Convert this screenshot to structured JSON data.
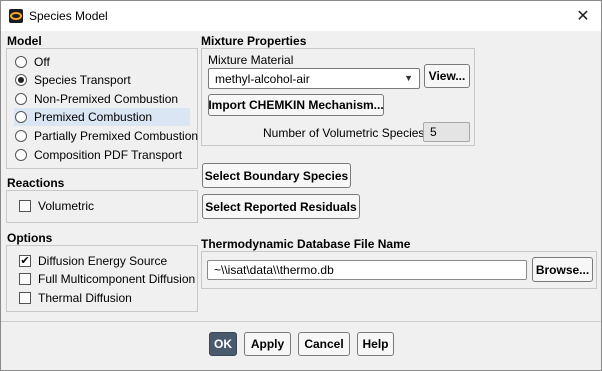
{
  "window": {
    "title": "Species Model",
    "close_label": "✕"
  },
  "model": {
    "heading": "Model",
    "options": [
      {
        "label": "Off",
        "selected": false
      },
      {
        "label": "Species Transport",
        "selected": true
      },
      {
        "label": "Non-Premixed Combustion",
        "selected": false
      },
      {
        "label": "Premixed Combustion",
        "selected": false
      },
      {
        "label": "Partially Premixed Combustion",
        "selected": false
      },
      {
        "label": "Composition PDF Transport",
        "selected": false
      }
    ]
  },
  "reactions": {
    "heading": "Reactions",
    "volumetric_label": "Volumetric",
    "volumetric_checked": false
  },
  "options": {
    "heading": "Options",
    "items": [
      {
        "label": "Diffusion Energy Source",
        "checked": true
      },
      {
        "label": "Full Multicomponent Diffusion",
        "checked": false
      },
      {
        "label": "Thermal Diffusion",
        "checked": false
      }
    ]
  },
  "mixture": {
    "heading": "Mixture Properties",
    "material_label": "Mixture Material",
    "material_value": "methyl-alcohol-air",
    "view_button": "View...",
    "import_button": "Import CHEMKIN Mechanism...",
    "num_species_label": "Number of Volumetric Species",
    "num_species_value": "5"
  },
  "boundary_button": "Select Boundary Species",
  "residuals_button": "Select Reported Residuals",
  "thermo": {
    "heading": "Thermodynamic Database File Name",
    "path_value": "~\\\\isat\\data\\\\thermo.db",
    "browse_button": "Browse..."
  },
  "footer": {
    "ok": "OK",
    "apply": "Apply",
    "cancel": "Cancel",
    "help": "Help"
  },
  "icons": {
    "app": "fluent-app-icon",
    "check": "✔",
    "chevron": "▼"
  }
}
